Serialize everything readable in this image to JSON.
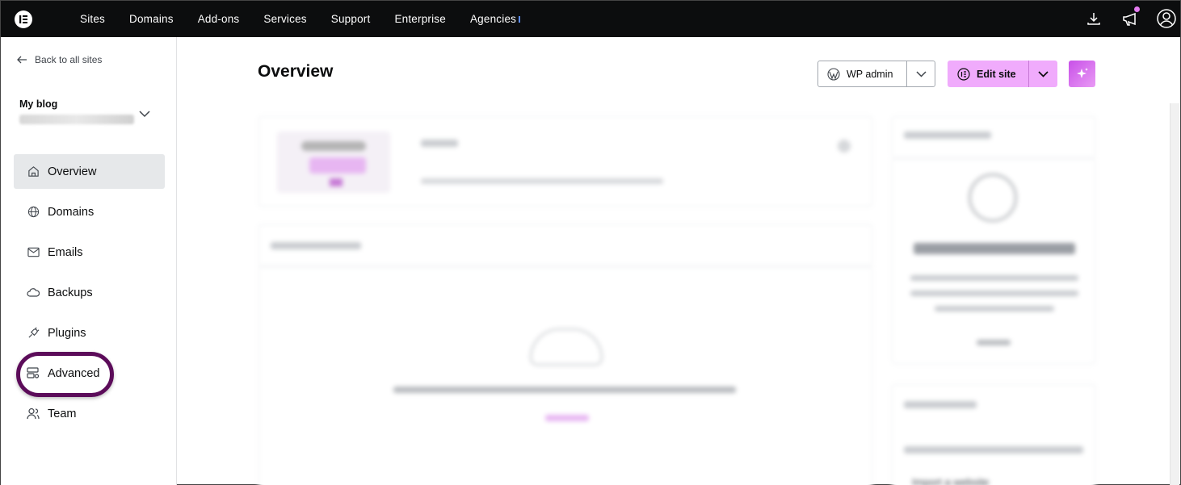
{
  "topbar": {
    "nav": [
      "Sites",
      "Domains",
      "Add-ons",
      "Services",
      "Support",
      "Enterprise",
      "Agencies"
    ],
    "icons": [
      "download-icon",
      "megaphone-icon",
      "user-icon"
    ],
    "accent": "#e47bf0"
  },
  "sidebar": {
    "back_label": "Back to all sites",
    "site_name": "My blog",
    "items": [
      {
        "label": "Overview",
        "icon": "home-icon"
      },
      {
        "label": "Domains",
        "icon": "globe-icon"
      },
      {
        "label": "Emails",
        "icon": "mail-icon"
      },
      {
        "label": "Backups",
        "icon": "cloud-icon"
      },
      {
        "label": "Plugins",
        "icon": "plug-icon"
      },
      {
        "label": "Advanced",
        "icon": "server-gear-icon"
      },
      {
        "label": "Team",
        "icon": "users-icon"
      }
    ],
    "active_item": "Overview",
    "highlighted_item": "Advanced",
    "highlight_color": "#5c0c5a"
  },
  "main": {
    "title": "Overview",
    "wp_admin_label": "WP admin",
    "edit_site_label": "Edit site",
    "edit_site_color": "#f0abfc"
  },
  "blurred": {
    "staging_link": "Import a website"
  }
}
